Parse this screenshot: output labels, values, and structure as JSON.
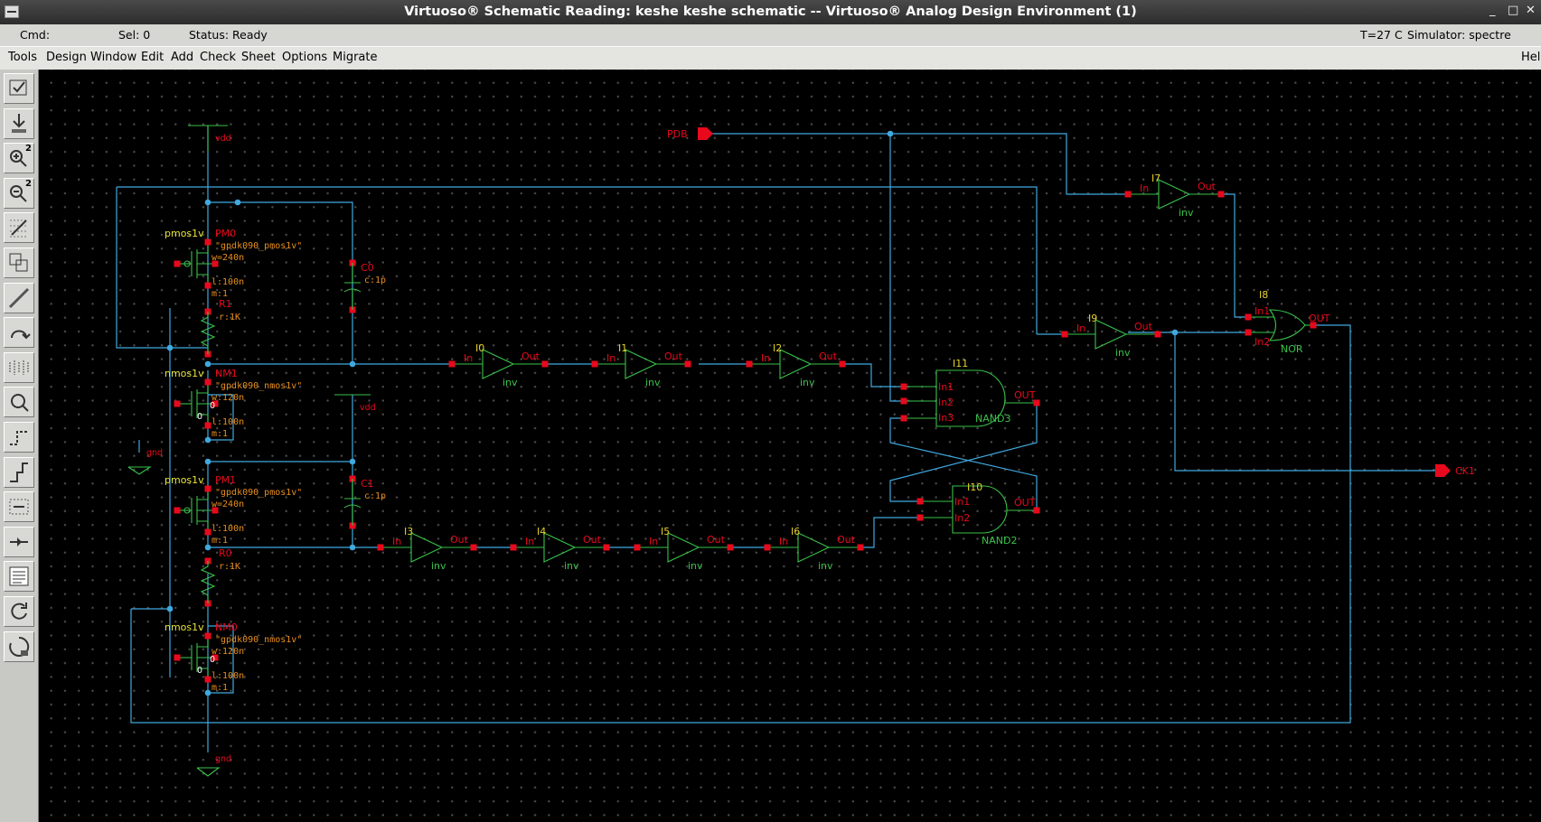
{
  "window": {
    "title": "Virtuoso® Schematic Reading: keshe keshe schematic -- Virtuoso® Analog Design Environment (1)",
    "controls": [
      "_",
      "□",
      "✕"
    ]
  },
  "status": {
    "cmd_label": "Cmd:",
    "sel_label": "Sel: 0",
    "status_label": "Status: Ready",
    "temp": "T=27 C",
    "simulator": "Simulator: spectre"
  },
  "menu": [
    "Tools",
    "Design",
    "Window",
    "Edit",
    "Add",
    "Check",
    "Sheet",
    "Options",
    "Migrate"
  ],
  "menu_help": "Help",
  "toolbar": [
    {
      "icon": "check-and-save-icon"
    },
    {
      "icon": "save-icon"
    },
    {
      "icon": "zoom-in-icon",
      "label": "2"
    },
    {
      "icon": "zoom-out-icon",
      "label": "2"
    },
    {
      "icon": "stretch-icon"
    },
    {
      "icon": "copy-icon"
    },
    {
      "icon": "wire-icon"
    },
    {
      "icon": "delete-icon"
    },
    {
      "icon": "undo-icon"
    },
    {
      "icon": "property-icon"
    },
    {
      "icon": "instance-icon"
    },
    {
      "icon": "wire-narrow-icon"
    },
    {
      "icon": "wire-wide-icon"
    },
    {
      "icon": "label-icon"
    },
    {
      "icon": "pin-icon"
    },
    {
      "icon": "cmd-options-icon"
    },
    {
      "icon": "repeat-icon"
    }
  ],
  "colors": {
    "wire": "#3fa9df",
    "pin": "#e8091c",
    "device": "#39c24a",
    "inst": "#e6d22a",
    "param": "#e98f1e",
    "label": "#e8091c"
  },
  "schematic": {
    "pins": {
      "pdb": "PDB",
      "ck1": "CK1"
    },
    "nets": {
      "vdd_top": "vdd",
      "vdd_mid": "vdd",
      "gnd_mid": "gnd",
      "gnd_bot": "gnd"
    },
    "transistors": [
      {
        "model": "pmos1v",
        "name": "PM0",
        "cell": "\"gpdk090_pmos1v\"",
        "w": "w=240n",
        "l": "l:100n",
        "m": "m:1"
      },
      {
        "model": "nmos1v",
        "name": "NM1",
        "cell": "\"gpdk090_nmos1v\"",
        "w": "w:120n",
        "l": "l:100n",
        "m": "m:1"
      },
      {
        "model": "pmos1v",
        "name": "PM1",
        "cell": "\"gpdk090_pmos1v\"",
        "w": "w=240n",
        "l": "l:100n",
        "m": "m:1"
      },
      {
        "model": "nmos1v",
        "name": "NM0",
        "cell": "\"gpdk090_nmos1v\"",
        "w": "w:120n",
        "l": "l:100n",
        "m": "m:1"
      }
    ],
    "resistors": [
      {
        "name": "R1",
        "val": "r:1K"
      },
      {
        "name": "R0",
        "val": "r:1K"
      }
    ],
    "capacitors": [
      {
        "name": "C0",
        "val": "c:1p"
      },
      {
        "name": "C1",
        "val": "c:1p"
      }
    ],
    "inverters": [
      {
        "name": "I0",
        "in": "In",
        "out": "Out",
        "cell": "inv"
      },
      {
        "name": "I1",
        "in": "In",
        "out": "Out",
        "cell": "inv"
      },
      {
        "name": "I2",
        "in": "In",
        "out": "Out",
        "cell": "inv"
      },
      {
        "name": "I3",
        "in": "In",
        "out": "Out",
        "cell": "inv"
      },
      {
        "name": "I4",
        "in": "In",
        "out": "Out",
        "cell": "inv"
      },
      {
        "name": "I5",
        "in": "In",
        "out": "Out",
        "cell": "inv"
      },
      {
        "name": "I6",
        "in": "In",
        "out": "Out",
        "cell": "inv"
      },
      {
        "name": "I7",
        "in": "In",
        "out": "Out",
        "cell": "inv"
      },
      {
        "name": "I9",
        "in": "In",
        "out": "Out",
        "cell": "inv"
      }
    ],
    "nand3": {
      "name": "I11",
      "cell": "NAND3",
      "in1": "In1",
      "in2": "In2",
      "in3": "In3",
      "out": "OUT"
    },
    "nand2": {
      "name": "I10",
      "cell": "NAND2",
      "in1": "In1",
      "in2": "In2",
      "out": "OUT"
    },
    "nor": {
      "name": "I8",
      "cell": "NOR",
      "in1": "In1",
      "in2": "In2",
      "out": "OUT"
    },
    "zero": "0"
  }
}
